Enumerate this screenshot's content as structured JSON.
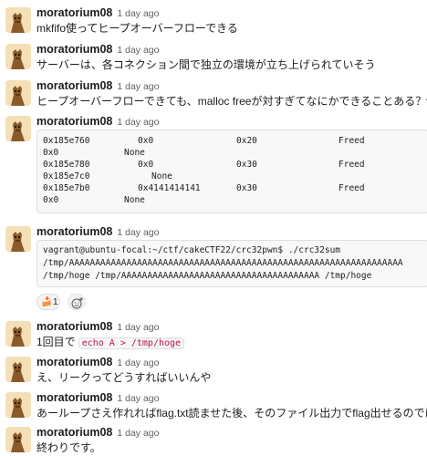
{
  "user": "moratorium08",
  "time": "1 day ago",
  "messages": [
    {
      "text": "mkfifo使ってヒープオーバーフローできる"
    },
    {
      "text": "サーバーは、各コネクション間で独立の環境が立ち上げられていそう"
    },
    {
      "text": "ヒープオーバーフローできても、malloc freeが対すぎてなにかできることある？w"
    },
    {
      "code_rows": [
        [
          "0x185e760",
          "0x0",
          "0x20",
          "Freed"
        ],
        [
          "0x0",
          "None",
          "",
          ""
        ],
        [
          "0x185e780",
          "0x0",
          "0x30",
          "Freed"
        ],
        [
          "0x185e7c0",
          "None",
          "",
          ""
        ],
        [
          "0x185e7b0",
          "0x4141414141",
          "0x30",
          "Freed"
        ],
        [
          "0x0",
          "None",
          "",
          ""
        ]
      ]
    },
    {
      "code_lines": [
        "vagrant@ubuntu-focal:~/ctf/cakeCTF22/crc32pwn$ ./crc32sum",
        "/tmp/AAAAAAAAAAAAAAAAAAAAAAAAAAAAAAAAAAAAAAAAAAAAAAAAAAAAAAAAAAAAAAAA",
        "/tmp/hoge /tmp/AAAAAAAAAAAAAAAAAAAAAAAAAAAAAAAAAAAAAA /tmp/hoge"
      ],
      "reaction": {
        "emoji": "🍰",
        "count": "1"
      }
    },
    {
      "text": "1回目で",
      "code": "echo A > /tmp/hoge"
    },
    {
      "text": "え、リークってどうすればいいんや"
    },
    {
      "text": "あーループさえ作れればflag.txt読ませた後、そのファイル出力でflag出せるのでは"
    },
    {
      "text": "終わりです。"
    }
  ]
}
